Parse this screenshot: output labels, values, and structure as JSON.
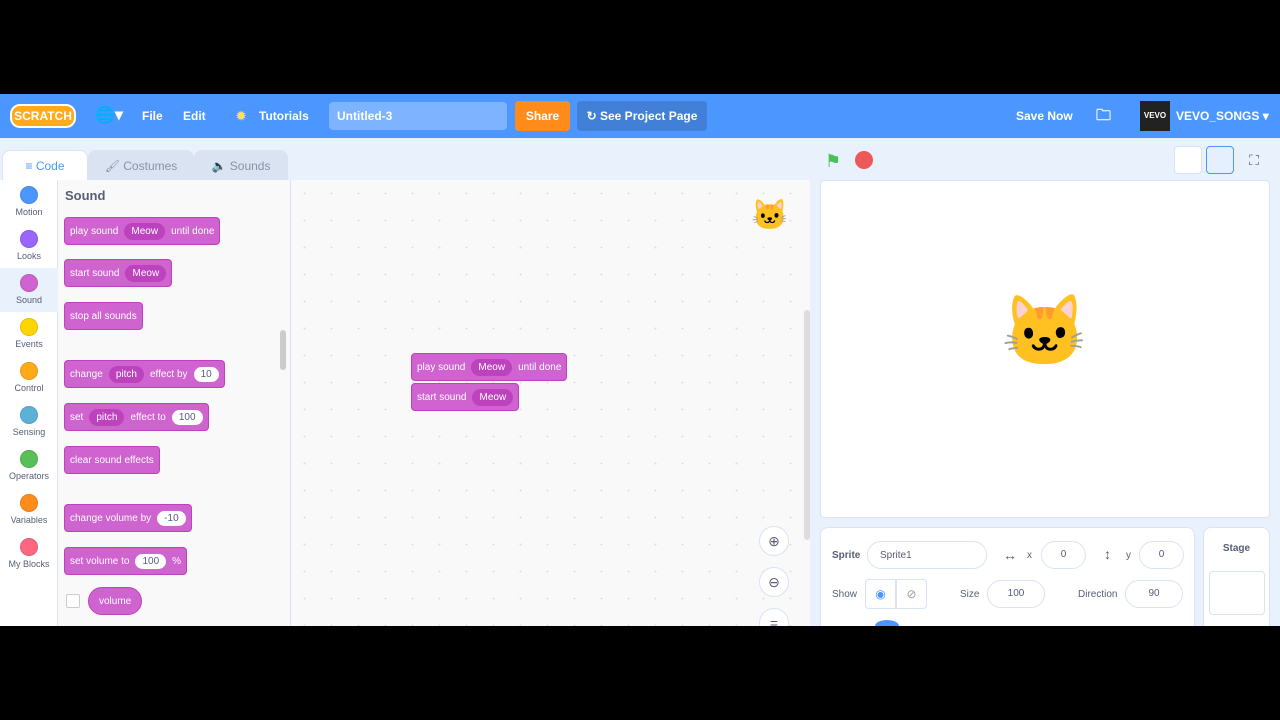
{
  "menubar": {
    "logo": "SCRATCH",
    "file": "File",
    "edit": "Edit",
    "tutorials": "Tutorials",
    "project_title": "Untitled-3",
    "share": "Share",
    "see_project_page": "See Project Page",
    "save_now": "Save Now",
    "username": "VEVO_SONGS",
    "avatar_text": "VEVO"
  },
  "tabs": [
    {
      "label": "Code"
    },
    {
      "label": "Costumes"
    },
    {
      "label": "Sounds"
    }
  ],
  "categories": [
    {
      "label": "Motion",
      "color": "#4c97ff"
    },
    {
      "label": "Looks",
      "color": "#9966ff"
    },
    {
      "label": "Sound",
      "color": "#cf63cf"
    },
    {
      "label": "Events",
      "color": "#ffd500"
    },
    {
      "label": "Control",
      "color": "#ffab19"
    },
    {
      "label": "Sensing",
      "color": "#5cb1d6"
    },
    {
      "label": "Operators",
      "color": "#59c059"
    },
    {
      "label": "Variables",
      "color": "#ff8c1a"
    },
    {
      "label": "My Blocks",
      "color": "#ff6680"
    }
  ],
  "palette": {
    "heading": "Sound",
    "blocks": {
      "play_until": {
        "a": "play sound",
        "b": "Meow",
        "c": "until done"
      },
      "start": {
        "a": "start sound",
        "b": "Meow"
      },
      "stop": {
        "a": "stop all sounds"
      },
      "change_effect": {
        "a": "change",
        "b": "pitch",
        "c": "effect by",
        "d": "10"
      },
      "set_effect": {
        "a": "set",
        "b": "pitch",
        "c": "effect to",
        "d": "100"
      },
      "clear": {
        "a": "clear sound effects"
      },
      "change_vol": {
        "a": "change volume by",
        "b": "-10"
      },
      "set_vol": {
        "a": "set volume to",
        "b": "100",
        "c": "%"
      },
      "volume": {
        "a": "volume"
      }
    }
  },
  "code": {
    "play_until": {
      "a": "play sound",
      "b": "Meow",
      "c": "until done"
    },
    "start": {
      "a": "start sound",
      "b": "Meow"
    }
  },
  "sprite_info": {
    "sprite_label": "Sprite",
    "sprite_name": "Sprite1",
    "x_label": "x",
    "x": "0",
    "y_label": "y",
    "y": "0",
    "show_label": "Show",
    "size_label": "Size",
    "size": "100",
    "direction_label": "Direction",
    "direction": "90"
  },
  "stage_pane": {
    "label": "Stage"
  }
}
